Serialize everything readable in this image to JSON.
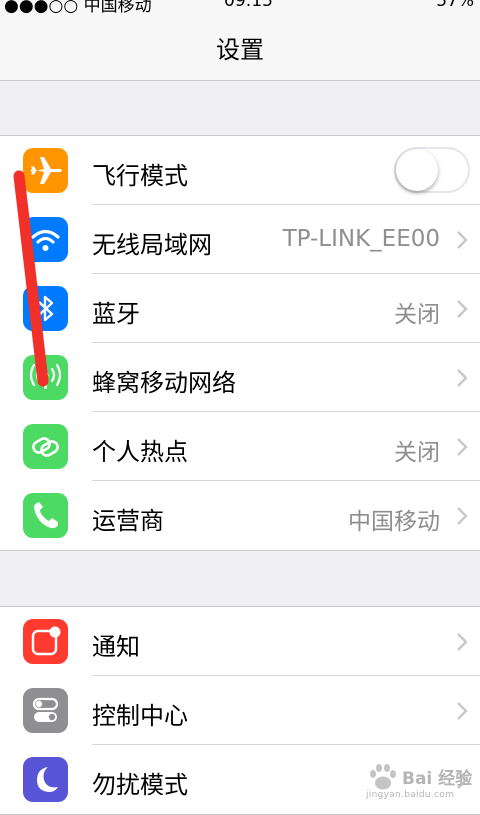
{
  "status_bar": {
    "carrier": "●●●○○ 中国移动",
    "time": "09:15",
    "battery": "57%"
  },
  "nav": {
    "title": "设置"
  },
  "groups": [
    {
      "rows": [
        {
          "label": "飞行模式",
          "value": "",
          "icon": "airplane-icon",
          "icon_color": "#ff9500",
          "toggle_on": false
        },
        {
          "label": "无线局域网",
          "value": "TP-LINK_EE00",
          "icon": "wifi-icon",
          "icon_color": "#007aff"
        },
        {
          "label": "蓝牙",
          "value": "关闭",
          "icon": "bluetooth-icon",
          "icon_color": "#007aff"
        },
        {
          "label": "蜂窝移动网络",
          "value": "",
          "icon": "cellular-antenna-icon",
          "icon_color": "#4cd964"
        },
        {
          "label": "个人热点",
          "value": "关闭",
          "icon": "hotspot-link-icon",
          "icon_color": "#4cd964"
        },
        {
          "label": "运营商",
          "value": "中国移动",
          "icon": "phone-icon",
          "icon_color": "#4cd964"
        }
      ]
    },
    {
      "rows": [
        {
          "label": "通知",
          "value": "",
          "icon": "notification-icon",
          "icon_color": "#ff3b30"
        },
        {
          "label": "控制中心",
          "value": "",
          "icon": "control-center-icon",
          "icon_color": "#8e8e93"
        },
        {
          "label": "勿扰模式",
          "value": "",
          "icon": "moon-icon",
          "icon_color": "#5856d6"
        }
      ]
    }
  ],
  "watermark": {
    "brand": "Bai 经验",
    "url": "jingyan.baidu.com"
  },
  "annotation": {
    "color": "#f2302a"
  }
}
